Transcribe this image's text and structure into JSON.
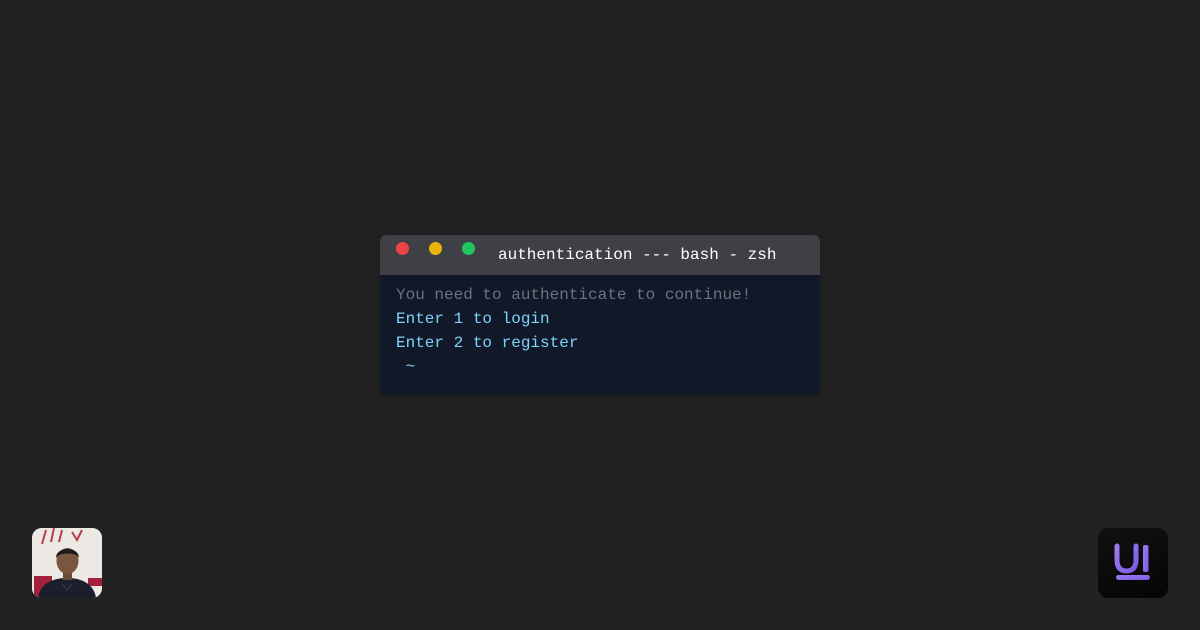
{
  "terminal": {
    "title": "authentication --- bash - zsh",
    "lines": [
      "You need to authenticate to continue!",
      "Enter 1 to login",
      "Enter 2 to register"
    ],
    "prompt_symbol": "",
    "prompt_path": "~"
  },
  "colors": {
    "background": "#222222",
    "titlebar": "#3f3f46",
    "terminal_body": "#111827",
    "close_dot": "#ef4444",
    "minimize_dot": "#eab308",
    "maximize_dot": "#22c55e",
    "muted_text": "#6b7280",
    "accent_text": "#7dd3fc"
  },
  "icons": {
    "author_avatar": "person-photo",
    "brand_logo": "ui-logo"
  },
  "logo_text": "UI"
}
